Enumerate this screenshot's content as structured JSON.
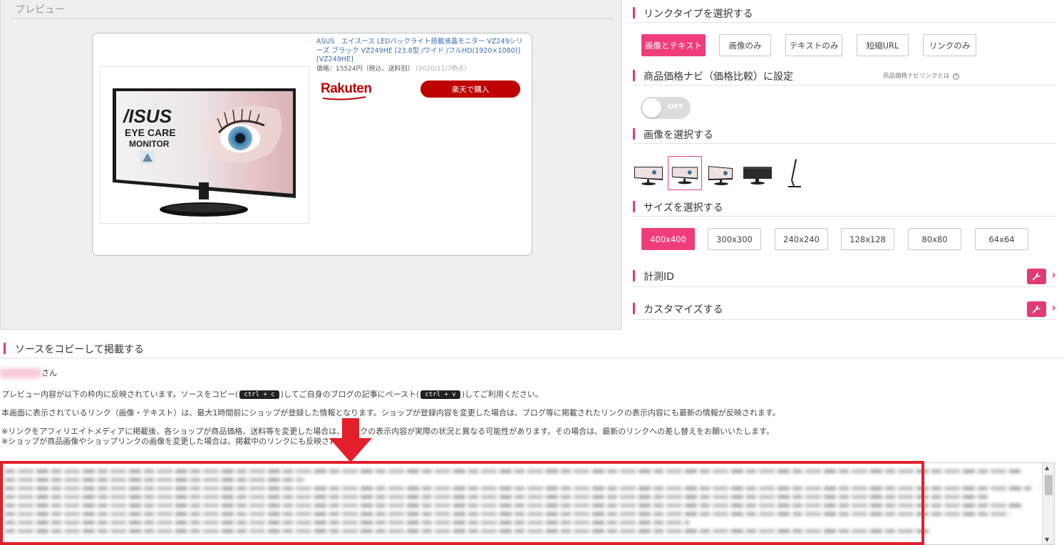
{
  "preview": {
    "title": "プレビュー",
    "product_name": "ASUS　エイスース LEDバックライト搭載液晶モニター VZ249シリーズ ブラック VZ249HE [23.8型 /ワイド /フルHD(1920×1080)] [VZ249HE]",
    "price": "価格：15524円（税込、送料別）",
    "price_date": "(2020/11/7時点)",
    "shop_logo": "Rakuten",
    "buy_label": "楽天で購入",
    "image_texts": {
      "brand": "/ISUS",
      "line1": "EYE CARE",
      "line2": "MONITOR"
    }
  },
  "link_type": {
    "heading": "リンクタイプを選択する",
    "options": [
      "画像とテキスト",
      "画像のみ",
      "テキストのみ",
      "短縮URL",
      "リンクのみ"
    ],
    "selected": "画像とテキスト"
  },
  "price_navi": {
    "heading": "商品価格ナビ（価格比較）に設定",
    "help": "商品価格ナビリンクとは",
    "toggle_state": "OFF"
  },
  "image_select": {
    "heading": "画像を選択する",
    "thumbnails": [
      "monitor-front-icon",
      "monitor-front-icon",
      "monitor-angle-icon",
      "monitor-back-icon",
      "monitor-side-icon"
    ],
    "selected_index": 1
  },
  "size_select": {
    "heading": "サイズを選択する",
    "options": [
      "400x400",
      "300x300",
      "240x240",
      "128x128",
      "80x80",
      "64x64"
    ],
    "selected": "400x400"
  },
  "tracking": {
    "heading": "計測ID"
  },
  "customize": {
    "heading": "カスタマイズする"
  },
  "source": {
    "heading": "ソースをコピーして掲載する",
    "greeting_suffix": "さん",
    "line1_a": "プレビュー内容が以下の枠内に反映されています。ソースをコピー(",
    "kbd_copy": "ctrl + c",
    "line1_b": ")してご自身のブログの記事にペースト(",
    "kbd_paste": "ctrl + v",
    "line1_c": ")してご利用ください。",
    "line2": "本画面に表示されているリンク（画像・テキスト）は、最大1時間前にショップが登録した情報となります。ショップが登録内容を変更した場合は、ブログ等に掲載されたリンクの表示内容にも最新の情報が反映されます。",
    "line3": "※リンクをアフィリエイトメディアに掲載後、各ショップが商品価格、送料等を変更した場合は、リンクの表示内容が実際の状況と異なる可能性があります。その場合は、最新のリンクへの差し替えをお願いいたします。",
    "line4": "※ショップが商品画像やショップリンクの画像を変更した場合は、掲載中のリンクにも反映されます。"
  },
  "colors": {
    "accent": "#ef3d7c",
    "rakuten_red": "#bf0000",
    "highlight": "#e21f2a"
  }
}
